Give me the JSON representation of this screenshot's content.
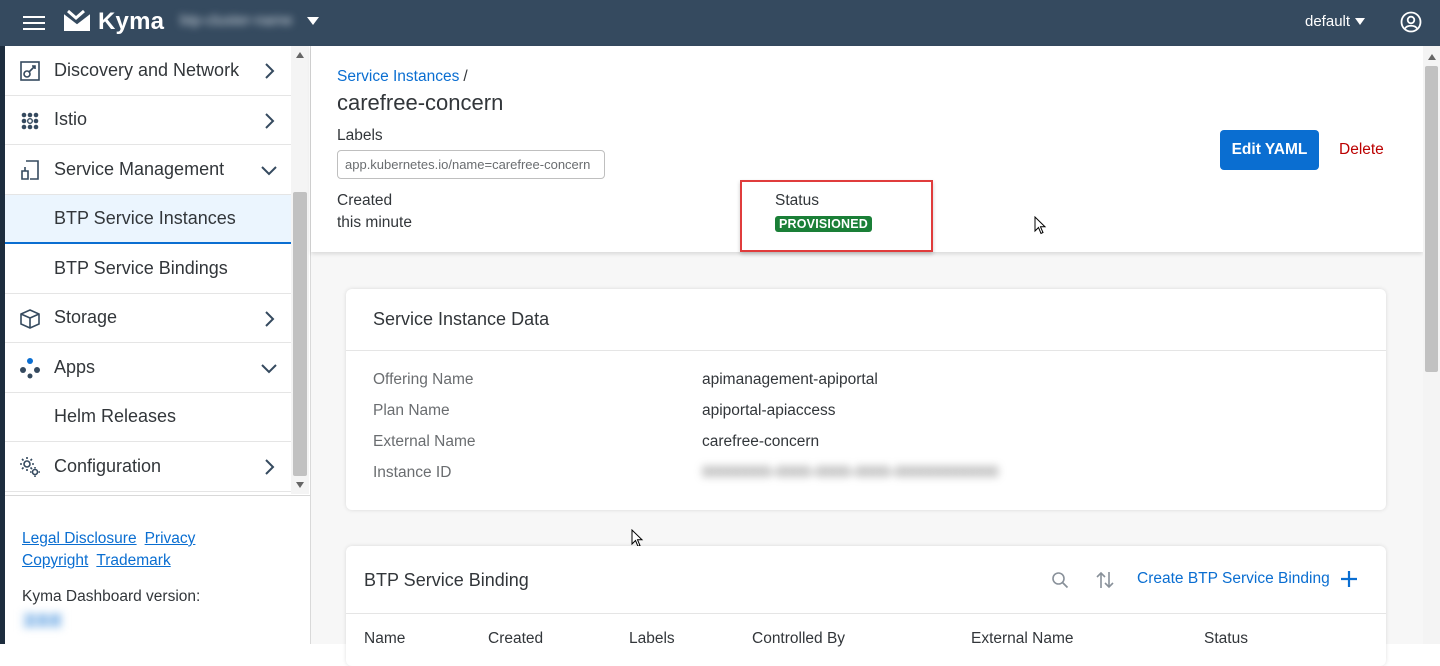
{
  "shellbar": {
    "product": "Kyma",
    "cluster": "btp-cluster-name",
    "namespace": "default"
  },
  "sidebar": {
    "items": [
      {
        "label": "Discovery and Network",
        "icon": "network-icon",
        "expanded": false
      },
      {
        "label": "Istio",
        "icon": "istio-icon",
        "expanded": false
      },
      {
        "label": "Service Management",
        "icon": "service-management-icon",
        "expanded": true
      },
      {
        "label": "BTP Service Instances",
        "sub": true,
        "selected": true
      },
      {
        "label": "BTP Service Bindings",
        "sub": true
      },
      {
        "label": "Storage",
        "icon": "storage-icon",
        "expanded": false
      },
      {
        "label": "Apps",
        "icon": "apps-icon",
        "expanded": true
      },
      {
        "label": "Helm Releases",
        "sub": true
      },
      {
        "label": "Configuration",
        "icon": "configuration-icon",
        "expanded": false
      }
    ],
    "footer": {
      "legal": "Legal Disclosure",
      "privacy": "Privacy",
      "copyright": "Copyright",
      "trademark": "Trademark",
      "version_label": "Kyma Dashboard version:",
      "version_value": "2.0.0"
    }
  },
  "header": {
    "breadcrumb": "Service Instances",
    "breadcrumb_sep": "/",
    "title": "carefree-concern",
    "labels_label": "Labels",
    "label_token": "app.kubernetes.io/name=carefree-concern",
    "created_label": "Created",
    "created_value": "this minute",
    "status_label": "Status",
    "status_value": "PROVISIONED",
    "edit_label": "Edit YAML",
    "delete_label": "Delete"
  },
  "instance_data": {
    "title": "Service Instance Data",
    "rows": [
      {
        "key": "Offering Name",
        "value": "apimanagement-apiportal"
      },
      {
        "key": "Plan Name",
        "value": "apiportal-apiaccess"
      },
      {
        "key": "External Name",
        "value": "carefree-concern"
      },
      {
        "key": "Instance ID",
        "value": "00000000-0000-0000-0000-000000000000"
      }
    ]
  },
  "bindings": {
    "title": "BTP Service Binding",
    "create_label": "Create BTP Service Binding",
    "columns": [
      "Name",
      "Created",
      "Labels",
      "Controlled By",
      "External Name",
      "Status"
    ]
  },
  "colors": {
    "shellbar": "#354a5f",
    "accent": "#0a6ed1",
    "status_ok": "#1a7f37",
    "delete": "#bb0000",
    "highlight": "#e03c3c"
  }
}
